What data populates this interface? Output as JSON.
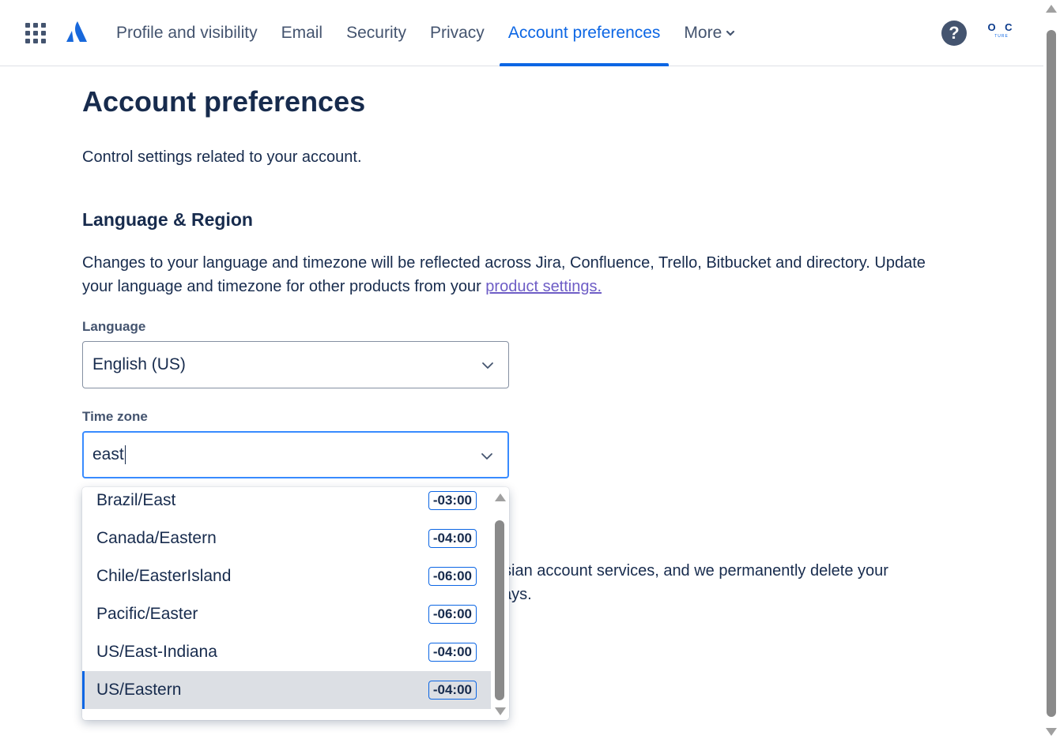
{
  "nav": {
    "app_switcher_icon": "grid-icon",
    "logo_icon": "atlassian-logo",
    "tabs": [
      {
        "label": "Profile and visibility",
        "active": false
      },
      {
        "label": "Email",
        "active": false
      },
      {
        "label": "Security",
        "active": false
      },
      {
        "label": "Privacy",
        "active": false
      },
      {
        "label": "Account preferences",
        "active": true
      },
      {
        "label": "More",
        "active": false,
        "has_dropdown": true
      }
    ],
    "help_label": "?",
    "avatar": {
      "main": "O C",
      "sub": "TURE"
    }
  },
  "page": {
    "title": "Account preferences",
    "description": "Control settings related to your account."
  },
  "language_region": {
    "title": "Language & Region",
    "description_before_link": "Changes to your language and timezone will be reflected across Jira, Confluence, Trello, Bitbucket and directory. Update your language and timezone for other products from your ",
    "link_text": "product settings.",
    "language": {
      "label": "Language",
      "value": "English (US)"
    },
    "timezone": {
      "label": "Time zone",
      "input_value": "east"
    }
  },
  "obscured_text": {
    "line1": "ssian account services, and we permanently delete your",
    "line2": "ays."
  },
  "timezone_options": [
    {
      "name": "Brazil/East",
      "offset": "-03:00",
      "selected": false
    },
    {
      "name": "Canada/Eastern",
      "offset": "-04:00",
      "selected": false
    },
    {
      "name": "Chile/EasterIsland",
      "offset": "-06:00",
      "selected": false
    },
    {
      "name": "Pacific/Easter",
      "offset": "-06:00",
      "selected": false
    },
    {
      "name": "US/East-Indiana",
      "offset": "-04:00",
      "selected": false
    },
    {
      "name": "US/Eastern",
      "offset": "-04:00",
      "selected": true
    }
  ],
  "colors": {
    "accent": "#0c66e4",
    "text": "#172b4d",
    "subtle_text": "#44546f",
    "link": "#6e5dc6",
    "selected_bg": "#dcdfe4",
    "focus_border": "#388bff"
  }
}
